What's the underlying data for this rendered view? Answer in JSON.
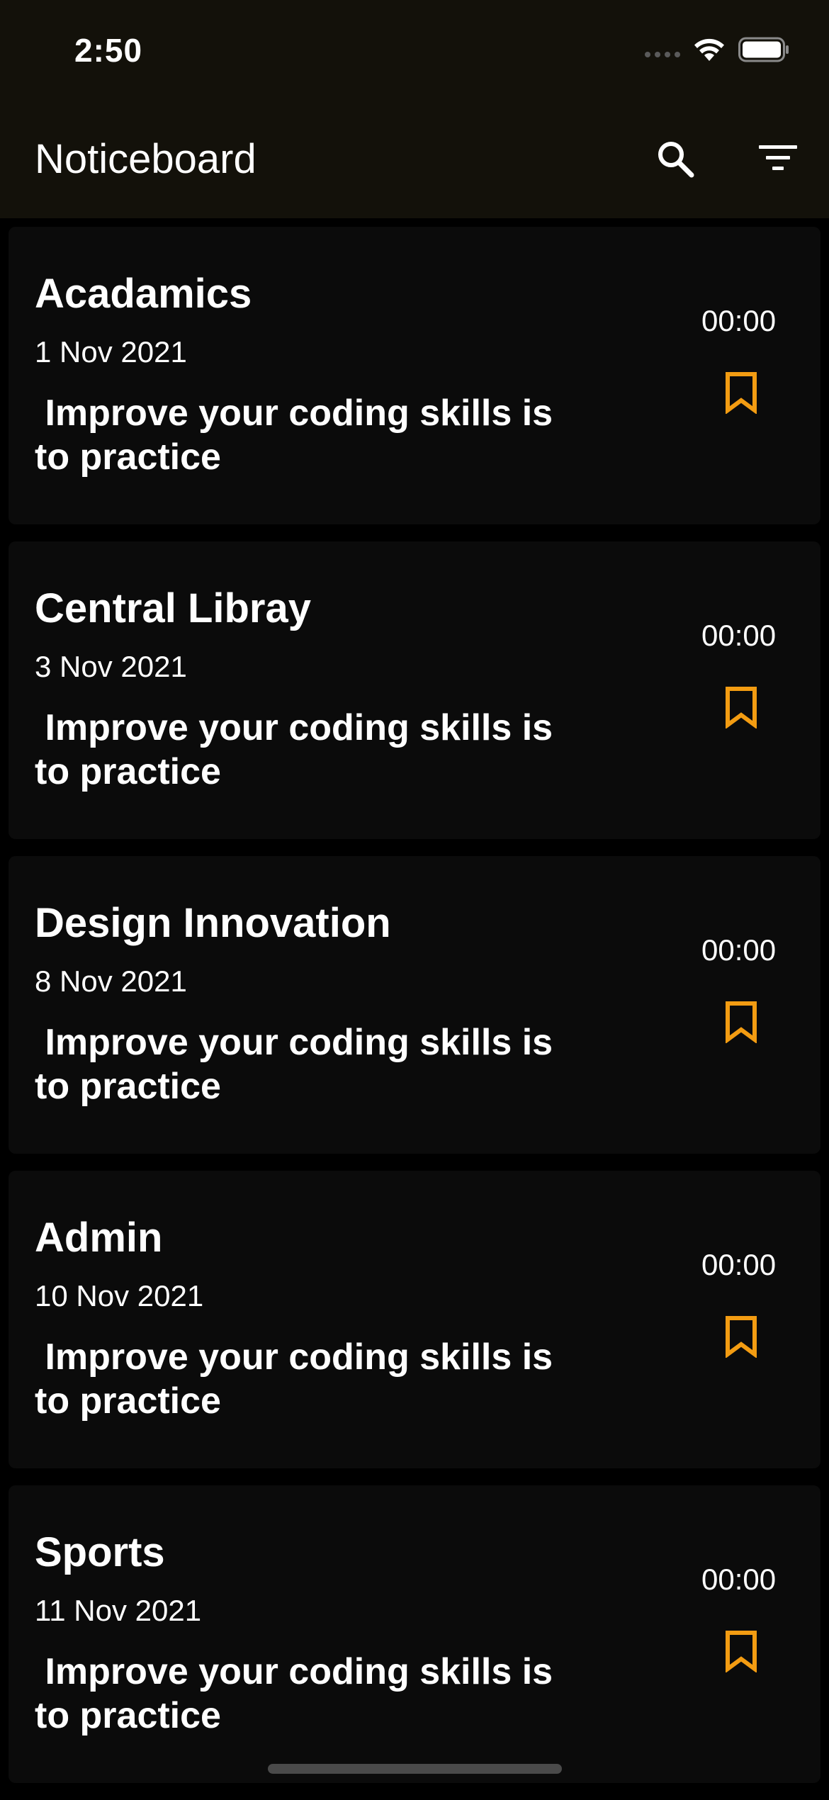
{
  "status_bar": {
    "time": "2:50"
  },
  "header": {
    "title": "Noticeboard",
    "search_icon": "search-icon",
    "filter_icon": "filter-icon"
  },
  "colors": {
    "background": "#000000",
    "header_background": "#13110a",
    "card_background": "#0b0b0b",
    "accent_bookmark": "#f39c12",
    "text": "#ffffff"
  },
  "notices": [
    {
      "title": "Acadamics",
      "date": "1 Nov 2021",
      "body": " Improve your coding skills is\nto practice",
      "time": "00:00",
      "bookmark_icon": "bookmark-outline-icon"
    },
    {
      "title": "Central Libray",
      "date": "3 Nov 2021",
      "body": " Improve your coding skills is\nto practice",
      "time": "00:00",
      "bookmark_icon": "bookmark-outline-icon"
    },
    {
      "title": "Design Innovation",
      "date": "8 Nov 2021",
      "body": " Improve your coding skills is\nto practice",
      "time": "00:00",
      "bookmark_icon": "bookmark-outline-icon"
    },
    {
      "title": "Admin",
      "date": "10 Nov 2021",
      "body": " Improve your coding skills is\nto practice",
      "time": "00:00",
      "bookmark_icon": "bookmark-outline-icon"
    },
    {
      "title": "Sports",
      "date": "11 Nov 2021",
      "body": " Improve your coding skills is\nto practice",
      "time": "00:00",
      "bookmark_icon": "bookmark-outline-icon"
    }
  ]
}
